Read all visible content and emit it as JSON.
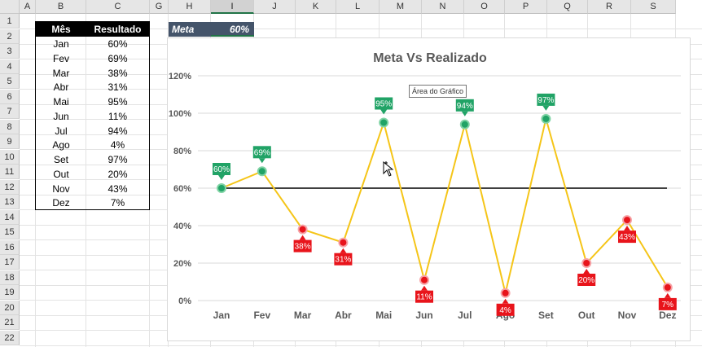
{
  "columns": [
    "A",
    "B",
    "C",
    "G",
    "H",
    "I",
    "J",
    "K",
    "L",
    "M",
    "N",
    "O",
    "P",
    "Q",
    "R",
    "S"
  ],
  "selected_column": "I",
  "rows": [
    "1",
    "2",
    "3",
    "4",
    "5",
    "6",
    "7",
    "8",
    "9",
    "10",
    "11",
    "12",
    "13",
    "14",
    "15",
    "16",
    "17",
    "18",
    "19",
    "20",
    "21",
    "22"
  ],
  "table": {
    "header_month": "Mês",
    "header_result": "Resultado",
    "rows": [
      {
        "mes": "Jan",
        "resultado": "60%"
      },
      {
        "mes": "Fev",
        "resultado": "69%"
      },
      {
        "mes": "Mar",
        "resultado": "38%"
      },
      {
        "mes": "Abr",
        "resultado": "31%"
      },
      {
        "mes": "Mai",
        "resultado": "95%"
      },
      {
        "mes": "Jun",
        "resultado": "11%"
      },
      {
        "mes": "Jul",
        "resultado": "94%"
      },
      {
        "mes": "Ago",
        "resultado": "4%"
      },
      {
        "mes": "Set",
        "resultado": "97%"
      },
      {
        "mes": "Out",
        "resultado": "20%"
      },
      {
        "mes": "Nov",
        "resultado": "43%"
      },
      {
        "mes": "Dez",
        "resultado": "7%"
      }
    ]
  },
  "meta": {
    "label": "Meta",
    "value": "60%"
  },
  "tooltip": "Área do Gráfico",
  "colors": {
    "line": "#f5c518",
    "above_marker": "#21a366",
    "below_marker": "#e8141b",
    "target_line": "#000000",
    "meta_cell": "#44546a",
    "header_fill": "#000000"
  },
  "chart_data": {
    "type": "line",
    "title": "Meta Vs Realizado",
    "categories": [
      "Jan",
      "Fev",
      "Mar",
      "Abr",
      "Mai",
      "Jun",
      "Jul",
      "Ago",
      "Set",
      "Out",
      "Nov",
      "Dez"
    ],
    "values": [
      60,
      69,
      38,
      31,
      95,
      11,
      94,
      4,
      97,
      20,
      43,
      7
    ],
    "data_labels": [
      "60%",
      "69%",
      "38%",
      "31%",
      "95%",
      "11%",
      "94%",
      "4%",
      "97%",
      "20%",
      "43%",
      "7%"
    ],
    "target": 60,
    "yticks": [
      "0%",
      "20%",
      "40%",
      "60%",
      "80%",
      "100%",
      "120%"
    ],
    "ylim": [
      0,
      120
    ],
    "grid": true,
    "legend": "none"
  }
}
